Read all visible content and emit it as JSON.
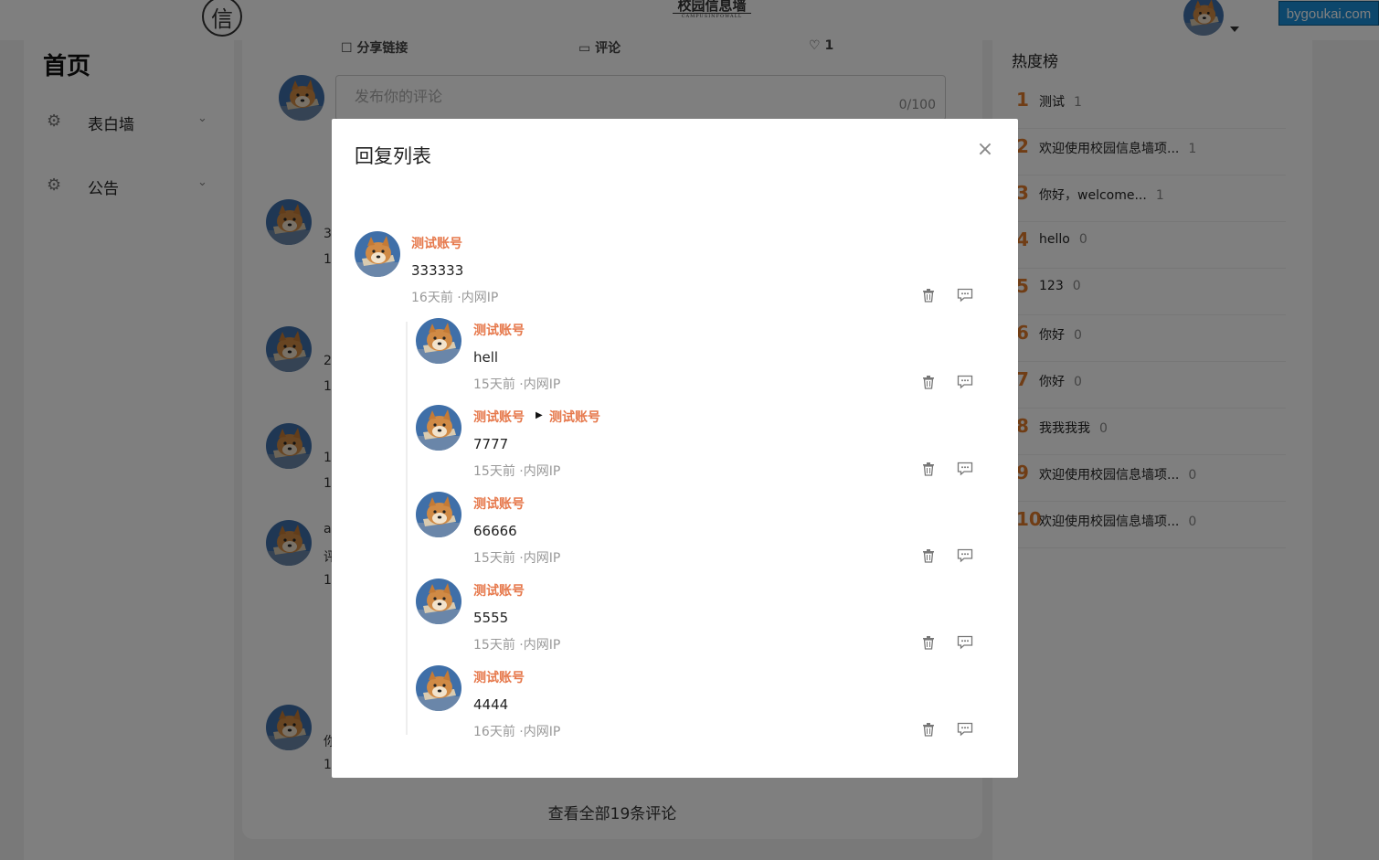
{
  "header": {
    "logo_glyph": "信",
    "brand_title": "校园信息墙",
    "brand_sub": "CAMPUSINFOWALL",
    "watermark": "bygoukai.com"
  },
  "sidebar": {
    "title": "首页",
    "items": [
      {
        "label": "表白墙"
      },
      {
        "label": "公告"
      }
    ]
  },
  "feed": {
    "share_label": "分享链接",
    "comment_label": "评论",
    "like_count": "1",
    "comment_placeholder": "发布你的评论",
    "comment_counter": "0/100",
    "see_all": "查看全部19条评论",
    "partial": [
      "3",
      "1",
      "2",
      "1",
      "1",
      "1",
      "a",
      "评",
      "1",
      "你",
      "1"
    ]
  },
  "hot": {
    "title": "热度榜",
    "items": [
      {
        "rank": "1",
        "text": "测试",
        "count": "1"
      },
      {
        "rank": "2",
        "text": "欢迎使用校园信息墙项...",
        "count": "1"
      },
      {
        "rank": "3",
        "text": "你好，welcome...",
        "count": "1"
      },
      {
        "rank": "4",
        "text": "hello",
        "count": "0"
      },
      {
        "rank": "5",
        "text": "123",
        "count": "0"
      },
      {
        "rank": "6",
        "text": "你好",
        "count": "0"
      },
      {
        "rank": "7",
        "text": "你好",
        "count": "0"
      },
      {
        "rank": "8",
        "text": "我我我我",
        "count": "0"
      },
      {
        "rank": "9",
        "text": "欢迎使用校园信息墙项...",
        "count": "0"
      },
      {
        "rank": "10",
        "text": "欢迎使用校园信息墙项...",
        "count": "0"
      }
    ]
  },
  "modal": {
    "title": "回复列表",
    "root": {
      "author": "测试账号",
      "content": "333333",
      "meta": "16天前 ·内网IP"
    },
    "replies": [
      {
        "author": "测试账号",
        "reply_to": "",
        "content": "hell",
        "meta": "15天前 ·内网IP"
      },
      {
        "author": "测试账号",
        "reply_to": "测试账号",
        "content": "7777",
        "meta": "15天前 ·内网IP"
      },
      {
        "author": "测试账号",
        "reply_to": "",
        "content": "66666",
        "meta": "15天前 ·内网IP"
      },
      {
        "author": "测试账号",
        "reply_to": "",
        "content": "5555",
        "meta": "15天前 ·内网IP"
      },
      {
        "author": "测试账号",
        "reply_to": "",
        "content": "4444",
        "meta": "16天前 ·内网IP"
      }
    ]
  },
  "colors": {
    "author": "#e6784b",
    "rank": "#e07a2a",
    "watermark_bg": "#1a8fd8"
  }
}
